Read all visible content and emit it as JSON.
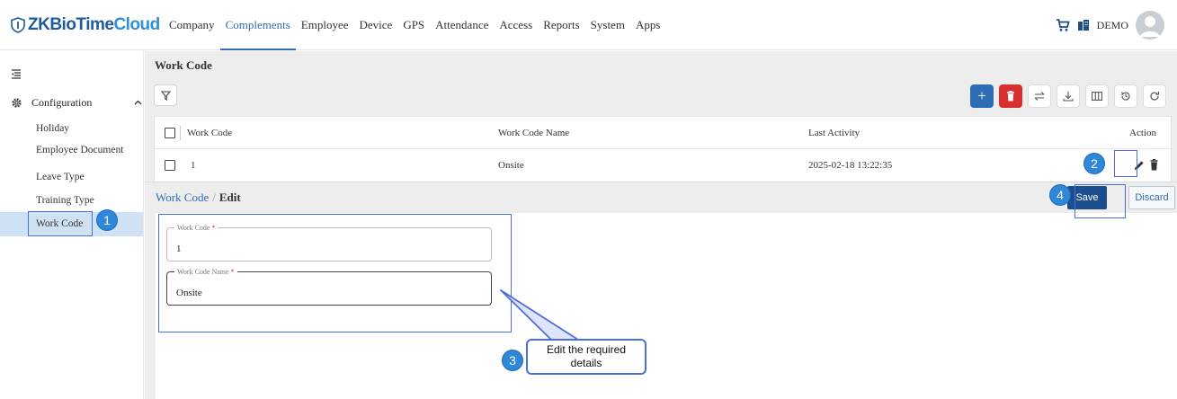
{
  "app": {
    "logo_text_a": "ZKBioTime",
    "logo_text_b": "Cloud",
    "brand_color": "#1f5a9c",
    "accent_color": "#2e6db4"
  },
  "nav": {
    "items": [
      {
        "label": "Company"
      },
      {
        "label": "Complements",
        "active": true
      },
      {
        "label": "Employee"
      },
      {
        "label": "Device"
      },
      {
        "label": "GPS"
      },
      {
        "label": "Attendance"
      },
      {
        "label": "Access"
      },
      {
        "label": "Reports"
      },
      {
        "label": "System"
      },
      {
        "label": "Apps"
      }
    ]
  },
  "header_right": {
    "company": "DEMO",
    "icons": [
      "cart-icon",
      "building-icon",
      "user-avatar-icon"
    ]
  },
  "sidebar": {
    "group_label": "Configuration",
    "items": [
      {
        "label": "Holiday"
      },
      {
        "label": "Employee Document"
      },
      {
        "label": "Leave Type"
      },
      {
        "label": "Training Type"
      },
      {
        "label": "Work Code",
        "active": true
      }
    ]
  },
  "page": {
    "title": "Work Code"
  },
  "table": {
    "columns": [
      "Work Code",
      "Work Code Name",
      "Last Activity",
      "Action"
    ],
    "rows": [
      {
        "work_code": "1",
        "work_code_name": "Onsite",
        "last_activity": "2025-02-18 13:22:35"
      }
    ]
  },
  "toolbar": {
    "icons": [
      "filter-icon",
      "add-icon",
      "delete-icon",
      "transfer-icon",
      "download-icon",
      "columns-icon",
      "history-icon",
      "refresh-icon"
    ],
    "add_color": "#2c6db5",
    "delete_color": "#d9302f"
  },
  "edit": {
    "breadcrumb_root": "Work Code",
    "breadcrumb_sep": "/",
    "breadcrumb_current": "Edit",
    "save_label": "Save",
    "discard_label": "Discard",
    "fields": [
      {
        "label": "Work Code",
        "required_mark": "*",
        "value": "1"
      },
      {
        "label": "Work Code Name",
        "required_mark": "*",
        "value": "Onsite"
      }
    ]
  },
  "annotations": {
    "step_1": "1",
    "step_2": "2",
    "step_3": "3",
    "step_4": "4",
    "callout_text": "Edit the required details",
    "highlight_color": "#4a6ee0",
    "badge_color": "#2f87d8"
  }
}
